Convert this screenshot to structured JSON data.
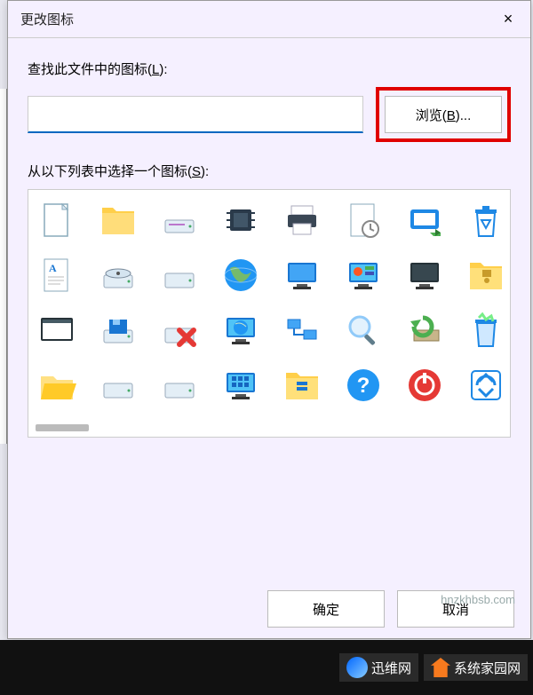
{
  "dialog": {
    "title": "更改图标",
    "close_label": "×",
    "path_label_pre": "查找此文件中的图标(",
    "path_label_key": "L",
    "path_label_post": "):",
    "path_value": "",
    "browse_label": "浏览(B)...",
    "select_label_pre": "从以下列表中选择一个图标(",
    "select_label_key": "S",
    "select_label_post": "):",
    "ok_label": "确定",
    "cancel_label": "取消"
  },
  "icons": [
    {
      "name": "blank-document-icon"
    },
    {
      "name": "folder-icon"
    },
    {
      "name": "drive-icon"
    },
    {
      "name": "chip-icon"
    },
    {
      "name": "printer-icon"
    },
    {
      "name": "recent-document-icon"
    },
    {
      "name": "run-window-icon"
    },
    {
      "name": "recycle-bin-empty-icon"
    },
    {
      "name": "text-document-icon"
    },
    {
      "name": "optical-drive-icon"
    },
    {
      "name": "hard-drive-icon"
    },
    {
      "name": "globe-icon"
    },
    {
      "name": "network-monitor-icon"
    },
    {
      "name": "control-panel-monitor-icon"
    },
    {
      "name": "night-mode-monitor-icon"
    },
    {
      "name": "zip-folder-icon"
    },
    {
      "name": "window-icon"
    },
    {
      "name": "floppy-drive-icon"
    },
    {
      "name": "drive-error-icon"
    },
    {
      "name": "globe-monitor-icon"
    },
    {
      "name": "network-computers-icon"
    },
    {
      "name": "magnifier-icon"
    },
    {
      "name": "system-restore-icon"
    },
    {
      "name": "recycle-bin-full-icon"
    },
    {
      "name": "open-folder-icon"
    },
    {
      "name": "hard-drive2-icon"
    },
    {
      "name": "hard-drive3-icon"
    },
    {
      "name": "monitor-apps-icon"
    },
    {
      "name": "archive-folder-icon"
    },
    {
      "name": "help-icon"
    },
    {
      "name": "power-icon"
    },
    {
      "name": "recycle-action-icon"
    }
  ],
  "watermarks": {
    "url_tr": "hnzkhbsb.com",
    "brand1": "迅维网",
    "brand2": "系统家园网"
  }
}
